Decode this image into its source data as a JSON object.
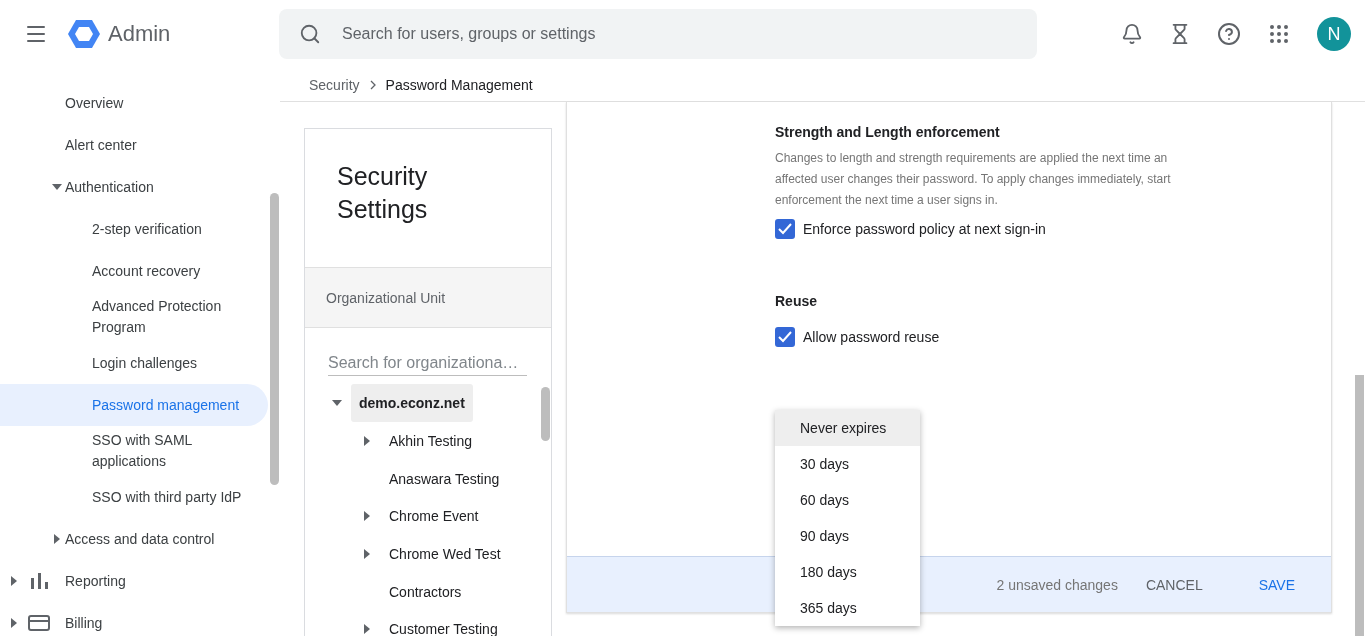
{
  "header": {
    "app_name": "Admin",
    "search": {
      "placeholder": "Search for users, groups or settings"
    },
    "avatar": "N"
  },
  "sidebar": {
    "items": [
      {
        "kind": "link",
        "label": "Overview",
        "selected": false
      },
      {
        "kind": "link",
        "label": "Alert center",
        "selected": false
      },
      {
        "kind": "group",
        "label": "Authentication",
        "expanded": true,
        "selected": false,
        "children": [
          {
            "kind": "link",
            "label": "2-step verification",
            "selected": false
          },
          {
            "kind": "link",
            "label": "Account recovery",
            "selected": false
          },
          {
            "kind": "link",
            "label": "Advanced Protection Program",
            "selected": false
          },
          {
            "kind": "link",
            "label": "Login challenges",
            "selected": false
          },
          {
            "kind": "link",
            "label": "Password management",
            "selected": true
          },
          {
            "kind": "link",
            "label": "SSO with SAML applications",
            "selected": false
          },
          {
            "kind": "link",
            "label": "SSO with third party IdP",
            "selected": false
          }
        ]
      },
      {
        "kind": "group",
        "label": "Access and data control",
        "expanded": false,
        "selected": false
      },
      {
        "kind": "section",
        "label": "Reporting",
        "expanded": false,
        "selected": false
      },
      {
        "kind": "section",
        "label": "Billing",
        "expanded": false,
        "selected": false
      }
    ]
  },
  "breadcrumb": [
    "Security",
    "Password Management"
  ],
  "org_panel": {
    "title": "Security Settings",
    "section_label": "Organizational Unit",
    "search": {
      "placeholder": "Search for organizationa…"
    },
    "tree": {
      "label": "demo.econz.net",
      "expanded": true,
      "selected": true,
      "children": [
        {
          "label": "Akhin Testing",
          "expandable": true,
          "selected": false
        },
        {
          "label": "Anaswara Testing",
          "expandable": false,
          "selected": false
        },
        {
          "label": "Chrome Event",
          "expandable": true,
          "selected": false
        },
        {
          "label": "Chrome Wed Test",
          "expandable": true,
          "selected": false
        },
        {
          "label": "Contractors",
          "expandable": false,
          "selected": false
        },
        {
          "label": "Customer Testing",
          "expandable": true,
          "selected": false
        }
      ]
    }
  },
  "settings": {
    "sections": [
      {
        "title": "Strength and Length enforcement",
        "description": "Changes to length and strength requirements are applied the next time an affected user changes their password. To apply changes immediately, start enforcement the next time a user signs in.",
        "checkbox": {
          "label": "Enforce password policy at next sign-in",
          "checked": true
        }
      },
      {
        "title": "Reuse",
        "checkbox": {
          "label": "Allow password reuse",
          "checked": true
        }
      }
    ],
    "dropdown": {
      "options": [
        {
          "label": "Never expires",
          "selected": true
        },
        {
          "label": "30 days",
          "selected": false
        },
        {
          "label": "60 days",
          "selected": false
        },
        {
          "label": "90 days",
          "selected": false
        },
        {
          "label": "180 days",
          "selected": false
        },
        {
          "label": "365 days",
          "selected": false
        }
      ]
    },
    "footer": {
      "status": "2 unsaved changes",
      "buttons": [
        {
          "label": "CANCEL",
          "kind": "secondary"
        },
        {
          "label": "SAVE",
          "kind": "primary"
        }
      ]
    }
  }
}
